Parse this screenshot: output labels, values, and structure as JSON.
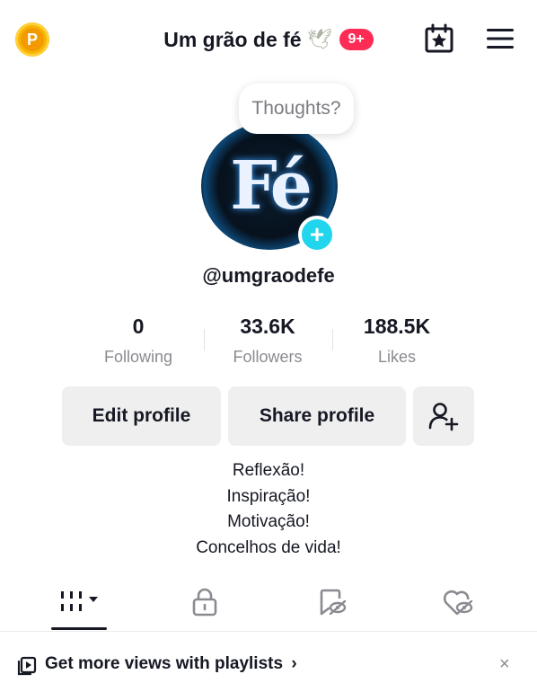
{
  "header": {
    "coin_letter": "P",
    "title": "Um grão de fé",
    "title_emoji": "🕊",
    "notification_badge": "9+",
    "icons": [
      "p-coin-icon",
      "calendar-star-icon",
      "hamburger-menu-icon"
    ]
  },
  "profile": {
    "thought_bubble": "Thoughts?",
    "avatar_text": "Fé",
    "add_symbol": "+",
    "username": "@umgraodefe"
  },
  "stats": [
    {
      "value": "0",
      "label": "Following"
    },
    {
      "value": "33.6K",
      "label": "Followers"
    },
    {
      "value": "188.5K",
      "label": "Likes"
    }
  ],
  "actions": {
    "edit_profile": "Edit profile",
    "share_profile": "Share profile",
    "add_friend_icon": "add-friend-icon"
  },
  "bio": [
    "Reflexão!",
    "Inspiração!",
    "Motivação!",
    "Concelhos de vida!"
  ],
  "tabs": [
    {
      "icon": "videos-grid-icon",
      "active": true
    },
    {
      "icon": "lock-icon",
      "active": false
    },
    {
      "icon": "reposts-icon",
      "active": false
    },
    {
      "icon": "liked-icon",
      "active": false
    }
  ],
  "banner": {
    "text": "Get more views with playlists",
    "chevron": "›",
    "close": "×"
  },
  "colors": {
    "accent_red": "#fe2c55",
    "avatar_add": "#20d5ec",
    "coin": "#f7b500",
    "button_bg": "#efefef",
    "muted_text": "#8a8b91"
  }
}
